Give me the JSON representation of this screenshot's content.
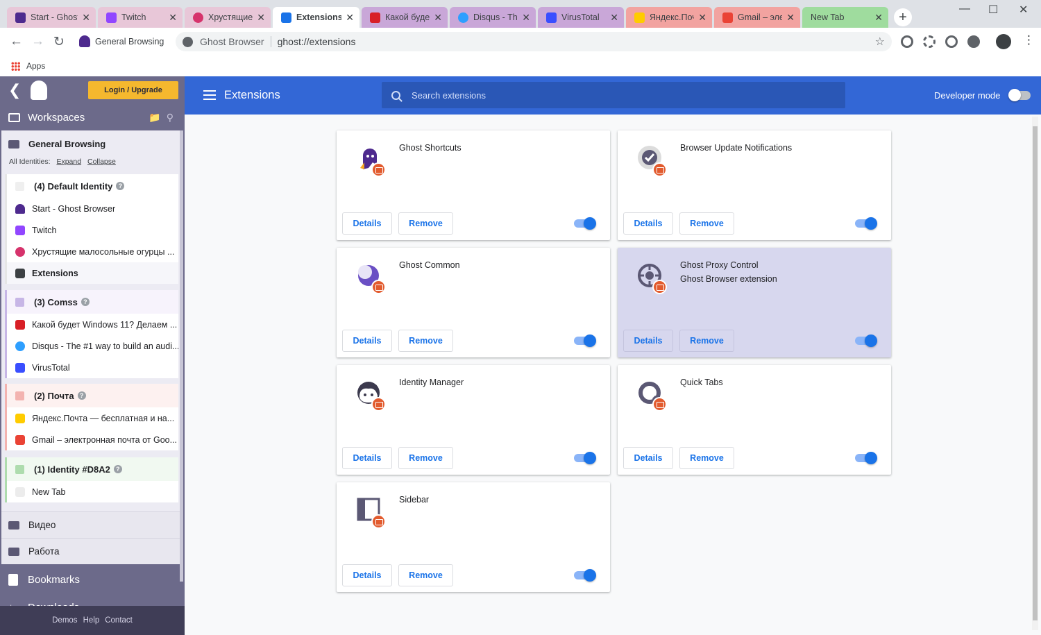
{
  "tabs": [
    {
      "title": "Start - Ghost",
      "icon": "ghost-icon",
      "color": "#e8c7d8"
    },
    {
      "title": "Twitch",
      "icon": "twitch-icon",
      "color": "#e8c7d8"
    },
    {
      "title": "Хрустящие м",
      "icon": "cucumber-icon",
      "color": "#e8c7d8"
    },
    {
      "title": "Extensions",
      "icon": "puzzle-icon",
      "color": "#ffffff"
    },
    {
      "title": "Какой будет",
      "icon": "news-icon",
      "color": "#c9a7d8"
    },
    {
      "title": "Disqus - The",
      "icon": "disqus-icon",
      "color": "#c9a7d8"
    },
    {
      "title": "VirusTotal",
      "icon": "virustotal-icon",
      "color": "#c9a7d8"
    },
    {
      "title": "Яндекс.Почт",
      "icon": "yandex-mail-icon",
      "color": "#f2a3a0"
    },
    {
      "title": "Gmail – элек",
      "icon": "gmail-icon",
      "color": "#f2a3a0"
    },
    {
      "title": "New Tab",
      "icon": "",
      "color": "#9fdc9e"
    }
  ],
  "tab_close": "✕",
  "toolbar": {
    "workspace_label": "General Browsing",
    "omnibox_site": "Ghost Browser",
    "omnibox_url": "ghost://extensions"
  },
  "bookmarks_bar": {
    "apps_label": "Apps"
  },
  "sidebar": {
    "login_label": "Login / Upgrade",
    "workspaces_label": "Workspaces",
    "workspace_title": "General Browsing",
    "identities_label": "All Identities:",
    "expand_label": "Expand",
    "collapse_label": "Collapse",
    "identities": [
      {
        "count": "(4)",
        "name": "Default Identity",
        "color": "#e6e6e6",
        "tabs": [
          "Start - Ghost Browser",
          "Twitch",
          "Хрустящие малосольные огурцы ...",
          "Extensions"
        ]
      },
      {
        "count": "(3)",
        "name": "Comss",
        "color": "#c7b6e6",
        "tabs": [
          "Какой будет Windows 11? Делаем ...",
          "Disqus - The #1 way to build an audi...",
          "VirusTotal"
        ]
      },
      {
        "count": "(2)",
        "name": "Почта",
        "color": "#f3b3b0",
        "tabs": [
          "Яндекс.Почта — бесплатная и на...",
          "Gmail – электронная почта от Goo..."
        ]
      },
      {
        "count": "(1)",
        "name": "Identity #D8A2",
        "color": "#aedcae",
        "tabs": [
          "New Tab"
        ]
      }
    ],
    "folders": [
      "Видео",
      "Работа"
    ],
    "bookmarks_label": "Bookmarks",
    "downloads_label": "Downloads",
    "footer": [
      "Demos",
      "Help",
      "Contact"
    ]
  },
  "extensions_page": {
    "title": "Extensions",
    "search_placeholder": "Search extensions",
    "developer_mode_label": "Developer mode",
    "developer_mode_on": false,
    "details_label": "Details",
    "remove_label": "Remove",
    "cards": [
      {
        "name": "Ghost Shortcuts",
        "description": "",
        "icon": "ghost-shortcuts-icon",
        "enabled": true
      },
      {
        "name": "Browser Update Notifications",
        "description": "",
        "icon": "update-check-icon",
        "enabled": true
      },
      {
        "name": "Ghost Common",
        "description": "",
        "icon": "ghost-common-icon",
        "enabled": true
      },
      {
        "name": "Ghost Proxy Control",
        "description": "Ghost Browser extension",
        "icon": "proxy-control-icon",
        "enabled": true,
        "highlighted": true
      },
      {
        "name": "Identity Manager",
        "description": "",
        "icon": "identity-manager-icon",
        "enabled": true
      },
      {
        "name": "Quick Tabs",
        "description": "",
        "icon": "quick-tabs-icon",
        "enabled": true
      },
      {
        "name": "Sidebar",
        "description": "",
        "icon": "sidebar-panel-icon",
        "enabled": true
      }
    ]
  }
}
